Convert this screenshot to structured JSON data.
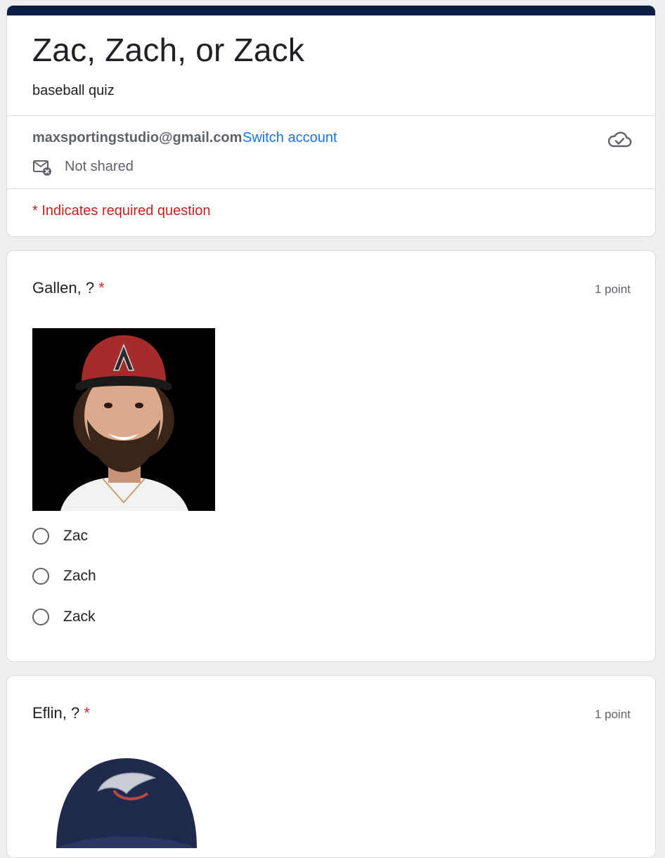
{
  "form": {
    "title": "Zac, Zach, or Zack",
    "description": "baseball quiz",
    "account_email": "maxsportingstudio@gmail.com",
    "switch_account": "Switch account",
    "not_shared": "Not shared",
    "required_note": "* Indicates required question"
  },
  "questions": [
    {
      "title": "Gallen, ?",
      "required_mark": "*",
      "points": "1 point",
      "options": [
        "Zac",
        "Zach",
        "Zack"
      ]
    },
    {
      "title": "Eflin, ?",
      "required_mark": "*",
      "points": "1 point"
    }
  ],
  "colors": {
    "header_band": "#0b1f45",
    "link": "#1a73e8",
    "required": "#c5221f"
  },
  "icons": [
    "cloud-check-icon",
    "mail-not-shared-icon"
  ]
}
